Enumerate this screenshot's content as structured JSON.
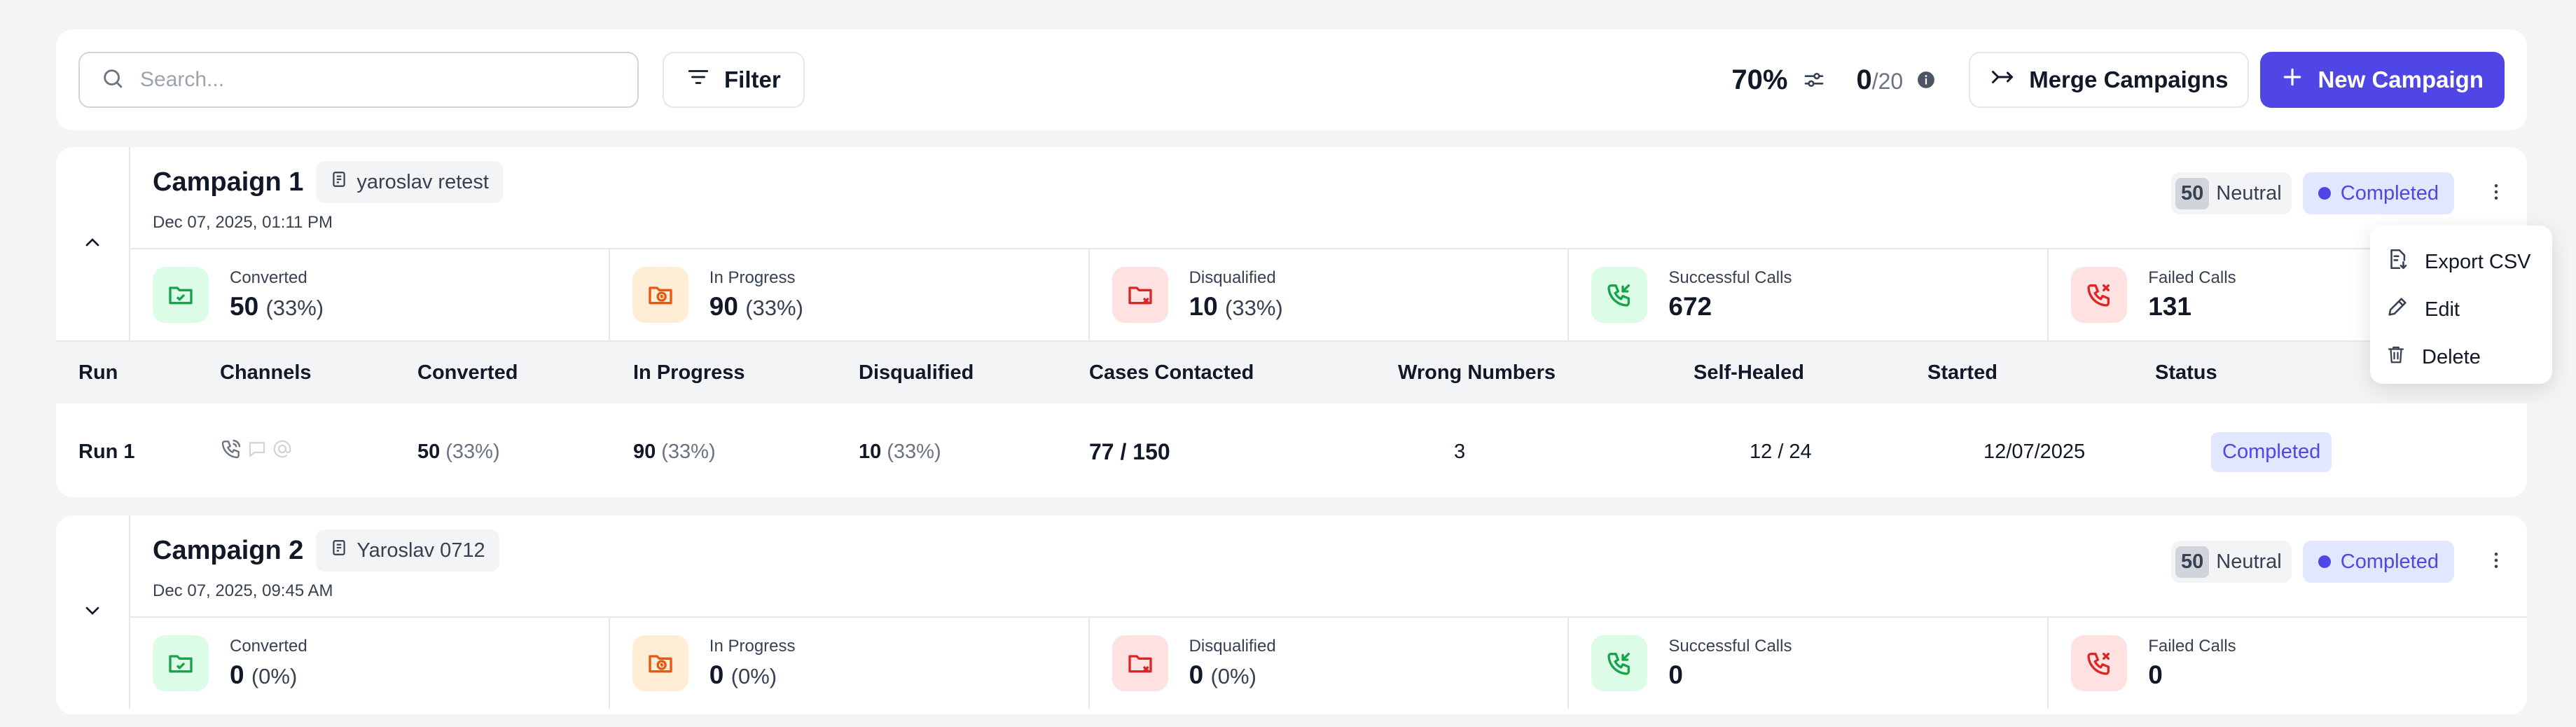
{
  "toolbar": {
    "search_placeholder": "Search...",
    "filter_label": "Filter",
    "percent": "70%",
    "count_value": "0",
    "count_total": "/20",
    "merge_label": "Merge Campaigns",
    "new_label": "New Campaign"
  },
  "colors": {
    "accent": "#4f46e5",
    "converted_bg": "#dcfce7",
    "in_progress_bg": "#ffedd5",
    "disqualified_bg": "#fee2e2",
    "successful_bg": "#dcfce7",
    "failed_bg": "#fee2e2"
  },
  "campaigns": [
    {
      "title": "Campaign 1",
      "tag": "yaroslav retest",
      "date": "Dec 07, 2025, 01:11 PM",
      "neutral_num": "50",
      "neutral_label": "Neutral",
      "status": "Completed",
      "metrics": {
        "converted": {
          "label": "Converted",
          "value": "50",
          "pct": "(33%)"
        },
        "in_progress": {
          "label": "In Progress",
          "value": "90",
          "pct": "(33%)"
        },
        "disqualified": {
          "label": "Disqualified",
          "value": "10",
          "pct": "(33%)"
        },
        "successful": {
          "label": "Successful Calls",
          "value": "672"
        },
        "failed": {
          "label": "Failed Calls",
          "value": "131"
        }
      },
      "runs_headers": [
        "Run",
        "Channels",
        "Converted",
        "In Progress",
        "Disqualified",
        "Cases Contacted",
        "Wrong Numbers",
        "Self-Healed",
        "Started",
        "Status"
      ],
      "runs": [
        {
          "run": "Run 1",
          "channels": [
            "phone-icon",
            "chat-icon",
            "at-icon"
          ],
          "converted": "50",
          "converted_pct": "(33%)",
          "in_progress": "90",
          "in_progress_pct": "(33%)",
          "disqualified": "10",
          "disqualified_pct": "(33%)",
          "cases_contacted": "77 / 150",
          "wrong_numbers": "3",
          "self_healed": "12 / 24",
          "started": "12/07/2025",
          "status": "Completed"
        }
      ]
    },
    {
      "title": "Campaign 2",
      "tag": "Yaroslav 0712",
      "date": "Dec 07, 2025, 09:45 AM",
      "neutral_num": "50",
      "neutral_label": "Neutral",
      "status": "Completed",
      "metrics": {
        "converted": {
          "label": "Converted",
          "value": "0",
          "pct": "(0%)"
        },
        "in_progress": {
          "label": "In Progress",
          "value": "0",
          "pct": "(0%)"
        },
        "disqualified": {
          "label": "Disqualified",
          "value": "0",
          "pct": "(0%)"
        },
        "successful": {
          "label": "Successful Calls",
          "value": "0"
        },
        "failed": {
          "label": "Failed Calls",
          "value": "0"
        }
      }
    }
  ],
  "menu": {
    "items": [
      {
        "label": "Export CSV",
        "icon": "file-export-icon"
      },
      {
        "label": "Edit",
        "icon": "pencil-icon"
      },
      {
        "label": "Delete",
        "icon": "trash-icon"
      }
    ]
  }
}
